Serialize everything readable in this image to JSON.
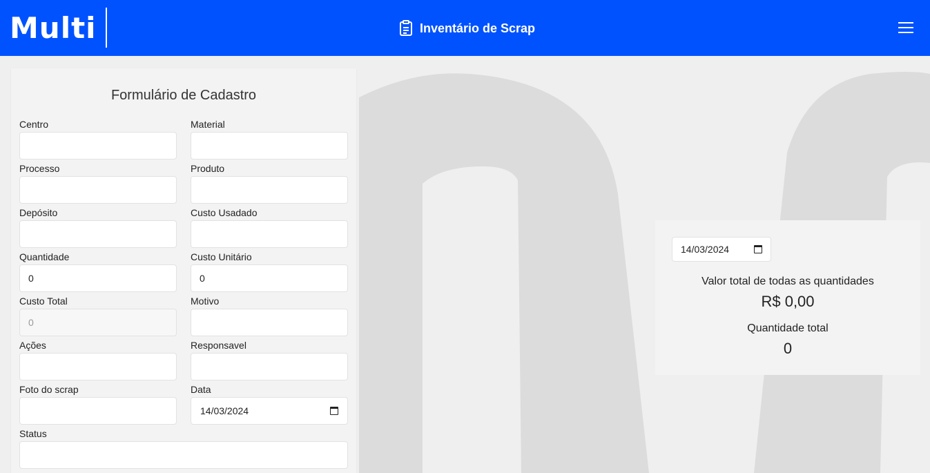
{
  "header": {
    "logo_text": "Multi",
    "title": "Inventário de Scrap",
    "title_icon": "clipboard-list-icon",
    "menu_icon": "hamburger-menu-icon",
    "bg_color": "#0052ff"
  },
  "form": {
    "title": "Formulário de Cadastro",
    "fields": {
      "centro": {
        "label": "Centro",
        "value": ""
      },
      "material": {
        "label": "Material",
        "value": ""
      },
      "processo": {
        "label": "Processo",
        "value": ""
      },
      "produto": {
        "label": "Produto",
        "value": ""
      },
      "deposito": {
        "label": "Depósito",
        "value": ""
      },
      "custo_usadado": {
        "label": "Custo Usadado",
        "value": ""
      },
      "quantidade": {
        "label": "Quantidade",
        "value": "0"
      },
      "custo_unitario": {
        "label": "Custo Unitário",
        "value": "0"
      },
      "custo_total": {
        "label": "Custo Total",
        "value": "0"
      },
      "motivo": {
        "label": "Motivo",
        "value": ""
      },
      "acoes": {
        "label": "Ações",
        "value": ""
      },
      "responsavel": {
        "label": "Responsavel",
        "value": ""
      },
      "foto": {
        "label": "Foto do scrap",
        "value": ""
      },
      "data": {
        "label": "Data",
        "value": "14/03/2024"
      },
      "status": {
        "label": "Status",
        "value": ""
      }
    }
  },
  "summary": {
    "date": "14/03/2024",
    "total_value_label": "Valor total de todas as quantidades",
    "total_value": "R$ 0,00",
    "total_qty_label": "Quantidade total",
    "total_qty": "0"
  }
}
